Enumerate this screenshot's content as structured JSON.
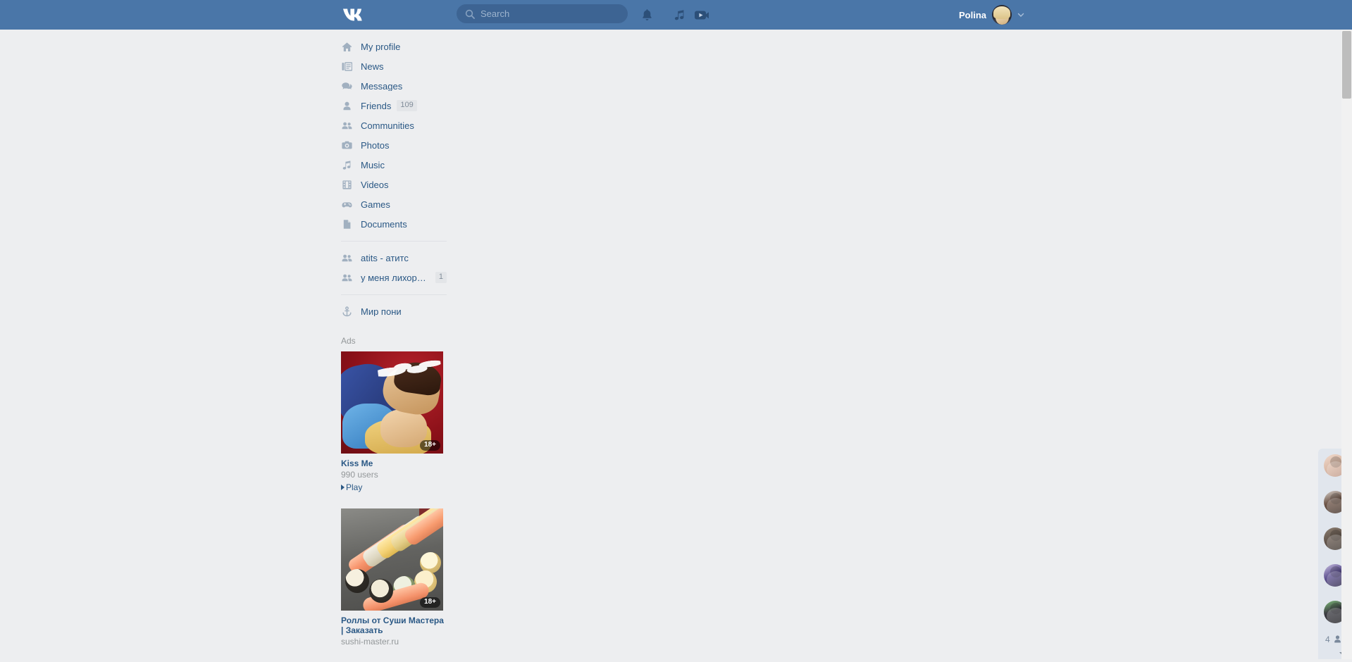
{
  "header": {
    "logo_alt": "VK",
    "search": {
      "placeholder": "Search",
      "value": ""
    },
    "icons": [
      {
        "name": "notifications-icon",
        "label": "Notifications"
      },
      {
        "name": "music-icon",
        "label": "Music"
      },
      {
        "name": "video-icon",
        "label": "Video"
      }
    ],
    "user": {
      "name": "Polina"
    },
    "colors": {
      "bar": "#4a76a8",
      "search_field": "#3d6493",
      "search_text": "#9db4ce"
    }
  },
  "sidebar": {
    "items": [
      {
        "label": "My profile",
        "icon": "home-icon",
        "badge": ""
      },
      {
        "label": "News",
        "icon": "news-icon",
        "badge": ""
      },
      {
        "label": "Messages",
        "icon": "messages-icon",
        "badge": ""
      },
      {
        "label": "Friends",
        "icon": "friend-icon",
        "badge": "109"
      },
      {
        "label": "Communities",
        "icon": "communities-icon",
        "badge": ""
      },
      {
        "label": "Photos",
        "icon": "camera-icon",
        "badge": ""
      },
      {
        "label": "Music",
        "icon": "music-note-icon",
        "badge": ""
      },
      {
        "label": "Videos",
        "icon": "film-icon",
        "badge": ""
      },
      {
        "label": "Games",
        "icon": "gamepad-icon",
        "badge": ""
      },
      {
        "label": "Documents",
        "icon": "document-icon",
        "badge": ""
      }
    ],
    "groups": [
      {
        "label": "atits - атитс",
        "icon": "communities-icon",
        "badge": ""
      },
      {
        "label": "у меня лихорад…",
        "icon": "communities-icon",
        "badge": "1"
      }
    ],
    "pinned": [
      {
        "label": "Мир пони",
        "icon": "anchor-icon",
        "badge": ""
      }
    ],
    "ads_label": "Ads"
  },
  "ads": [
    {
      "id": "kiss-me",
      "artwork": "romance-game-illustration",
      "age_badge": "18+",
      "title": "Kiss Me",
      "subtitle": "990 users",
      "action": "Play"
    },
    {
      "id": "sushi-master",
      "artwork": "sushi-platter-photo",
      "age_badge": "18+",
      "title": "Роллы от Суши Мастера | Заказать",
      "subtitle": "sushi-master.ru",
      "action": ""
    }
  ],
  "online_strip": {
    "friends": [
      {
        "name": "friend-avatar-1"
      },
      {
        "name": "friend-avatar-2"
      },
      {
        "name": "friend-avatar-3"
      },
      {
        "name": "friend-avatar-4"
      },
      {
        "name": "friend-avatar-5"
      }
    ],
    "count": "4"
  },
  "colors": {
    "page_bg": "#edeef0",
    "link": "#2a5885",
    "muted": "#939799",
    "badge_bg": "#e3e5e8"
  }
}
